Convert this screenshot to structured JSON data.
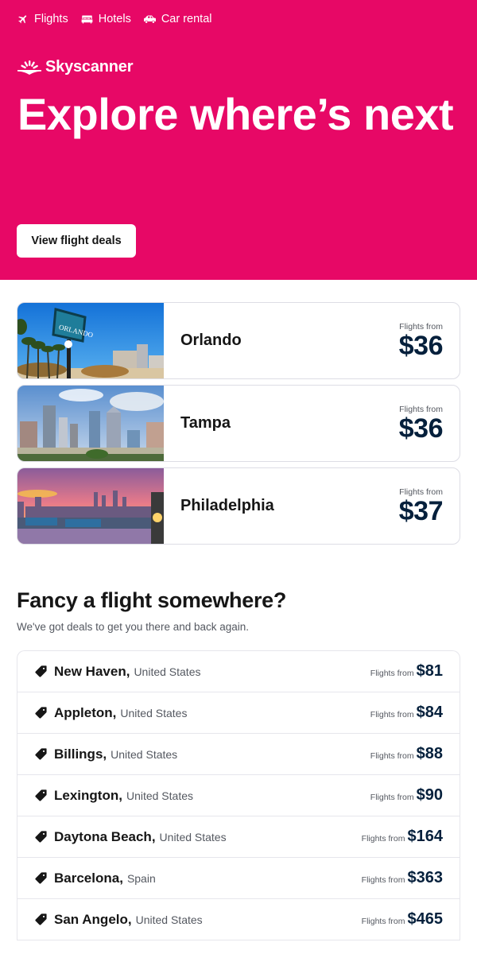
{
  "colors": {
    "brand": "#e70866",
    "price": "#05203c"
  },
  "nav": {
    "items": [
      {
        "label": "Flights",
        "icon": "plane-icon"
      },
      {
        "label": "Hotels",
        "icon": "bed-icon"
      },
      {
        "label": "Car rental",
        "icon": "car-icon"
      }
    ]
  },
  "brand": {
    "name": "Skyscanner"
  },
  "hero": {
    "title": "Explore where’s next",
    "cta_label": "View flight deals"
  },
  "destinations": [
    {
      "city": "Orlando",
      "from_label": "Flights from",
      "price": "$36",
      "image": "orlando-welcome-sign-photo"
    },
    {
      "city": "Tampa",
      "from_label": "Flights from",
      "price": "$36",
      "image": "tampa-skyline-photo"
    },
    {
      "city": "Philadelphia",
      "from_label": "Flights from",
      "price": "$37",
      "image": "philadelphia-sunset-skyline-photo"
    }
  ],
  "section": {
    "title": "Fancy a flight somewhere?",
    "subtitle": "We've got deals to get you there and back again."
  },
  "deals": [
    {
      "city": "New Haven,",
      "country": "United States",
      "from_label": "Flights from",
      "price": "$81"
    },
    {
      "city": "Appleton,",
      "country": "United States",
      "from_label": "Flights from",
      "price": "$84"
    },
    {
      "city": "Billings,",
      "country": "United States",
      "from_label": "Flights from",
      "price": "$88"
    },
    {
      "city": "Lexington,",
      "country": "United States",
      "from_label": "Flights from",
      "price": "$90"
    },
    {
      "city": "Daytona Beach,",
      "country": "United States",
      "from_label": "Flights from",
      "price": "$164"
    },
    {
      "city": "Barcelona,",
      "country": "Spain",
      "from_label": "Flights from",
      "price": "$363"
    },
    {
      "city": "San Angelo,",
      "country": "United States",
      "from_label": "Flights from",
      "price": "$465"
    }
  ]
}
